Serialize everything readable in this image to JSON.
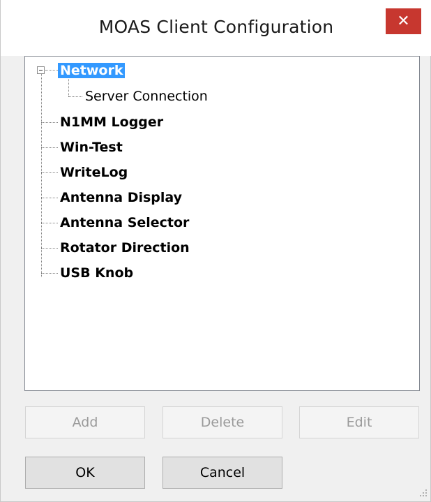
{
  "window": {
    "title": "MOAS Client Configuration",
    "close_label": "✕"
  },
  "tree": {
    "root": {
      "label": "Network",
      "selected": true,
      "expanded": true,
      "children": [
        {
          "label": "Server Connection"
        }
      ]
    },
    "items": [
      {
        "label": "N1MM Logger"
      },
      {
        "label": "Win-Test"
      },
      {
        "label": "WriteLog"
      },
      {
        "label": "Antenna Display"
      },
      {
        "label": "Antenna Selector"
      },
      {
        "label": "Rotator Direction"
      },
      {
        "label": "USB Knob"
      }
    ]
  },
  "buttons": {
    "add": {
      "label": "Add",
      "enabled": false
    },
    "delete": {
      "label": "Delete",
      "enabled": false
    },
    "edit": {
      "label": "Edit",
      "enabled": false
    },
    "ok": {
      "label": "OK",
      "enabled": true
    },
    "cancel": {
      "label": "Cancel",
      "enabled": true
    }
  },
  "colors": {
    "selection": "#3399ff",
    "close_button": "#c7372f"
  }
}
